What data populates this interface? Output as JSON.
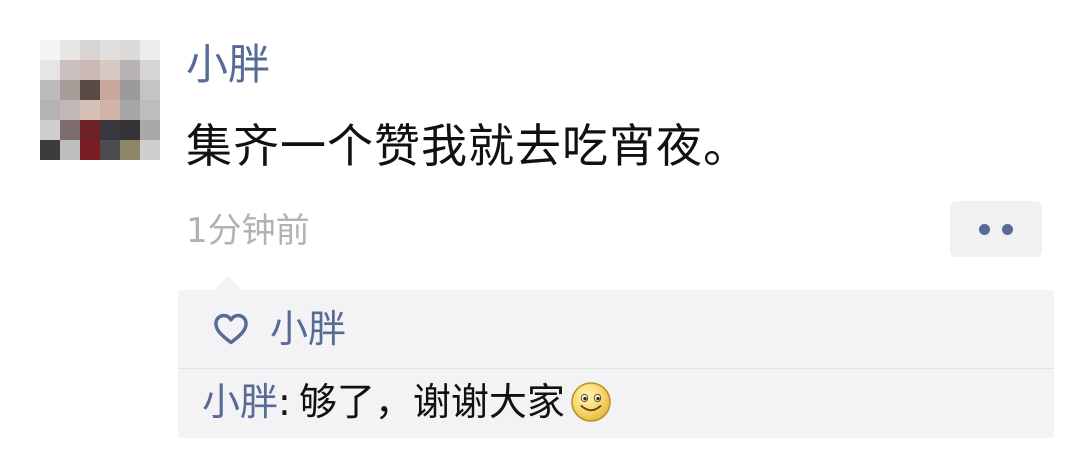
{
  "post": {
    "username": "小胖",
    "text": "集齐一个赞我就去吃宵夜。",
    "timestamp": "1分钟前",
    "more_icon": "more-dots-icon"
  },
  "likes": {
    "icon": "heart-outline-icon",
    "names": "小胖"
  },
  "comment": {
    "author": "小胖",
    "colon": ":",
    "text": "够了，谢谢大家",
    "emoji": "smile-emoji-icon"
  },
  "colors": {
    "link_blue": "#576b95",
    "text_dark": "#111111",
    "time_gray": "#b2b2b2",
    "box_bg": "#f3f3f5"
  }
}
